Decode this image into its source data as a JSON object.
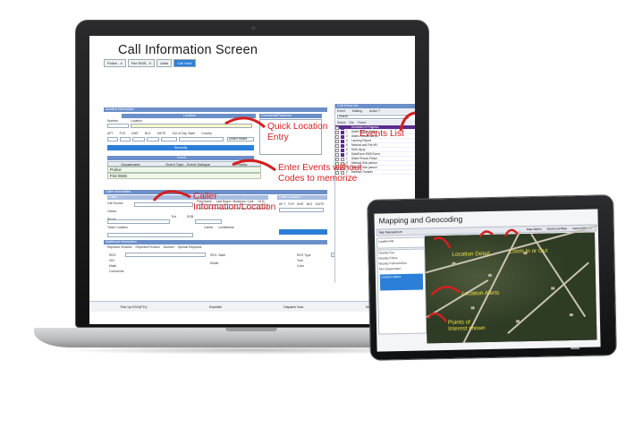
{
  "laptop": {
    "screen_title": "Call Information Screen",
    "tabs": [
      "Police - 4",
      "Fire EMS - 0",
      "Units",
      "Call Hold"
    ],
    "sections": {
      "incident": "Incident Information",
      "location_header": "Location",
      "comments": "Comments/Problems",
      "event": "Event",
      "caller": "Caller Information",
      "caller_left": "Caller",
      "caller_right": "Caller Location",
      "additional": "Additional Information"
    },
    "field_labels": {
      "number": "Number",
      "location": "Location",
      "apt": "APT",
      "flr": "FLR",
      "unit": "UNIT",
      "bld": "BLD",
      "suite": "SUITE",
      "out_of_city": "Out of City, State",
      "country": "Country",
      "country_value": "United States",
      "geoverify": "Geoverify"
    },
    "event_table": {
      "headers": [
        "Department",
        "Event Type - Event Subtype",
        "Priority"
      ],
      "rows": [
        "Police",
        "Fire EMS"
      ]
    },
    "caller_fields": [
      "Call Source",
      "Citizen",
      "Phone",
      "Tower Location"
    ],
    "caller_cols": [
      "First Name",
      "Last Name / Business / Unit",
      "OLN",
      "OLN State"
    ],
    "caller_extra": [
      "Ext",
      "DOB",
      "Carrier",
      "confidential"
    ],
    "caller_location_labels": [
      "AP T",
      "FLR",
      "UNIT",
      "BLD",
      "SUITE",
      "Out of City, State",
      "Co"
    ],
    "additional_tabs": [
      "Reported Vehicles",
      "Reported Persons",
      "Number",
      "Special Requests"
    ],
    "vehicle_fields": [
      "REG.",
      "VIN",
      "Make",
      "Comments",
      "REG. State",
      "Model",
      "REG Type",
      "Year",
      "Color",
      "Passenger (P)"
    ],
    "event_list_panel": {
      "header": "CAD Event List",
      "cols": [
        "Event",
        "Waiting",
        "Active T"
      ],
      "search": "Search",
      "sub_cols": [
        "Select",
        "Dis.",
        "Event"
      ],
      "items": [
        {
          "n": "",
          "label": "Domestic in Progress",
          "highlight": true
        },
        {
          "n": "1",
          "label": "Aided Person-Police"
        },
        {
          "n": "2",
          "label": "Alarm-Residential Bu"
        },
        {
          "n": "4",
          "label": "Larceny-Report"
        },
        {
          "n": "6",
          "label": "Medical and Fire MV"
        },
        {
          "n": "5",
          "label": "MVA-Injury"
        },
        {
          "n": "0",
          "label": "DataForce EMS Event"
        },
        {
          "n": "1",
          "label": "Aided Person-Police"
        },
        {
          "n": "0",
          "label": "Medical-Sick person"
        },
        {
          "n": "0",
          "label": "Medical-Sick person"
        },
        {
          "n": "0",
          "label": "Medical-Transfer"
        }
      ]
    },
    "bottom_buttons": [
      "Pick Up E911(F11)",
      "Expedite",
      "Dispatch Now",
      "Send to Disp"
    ],
    "callouts": {
      "quick_location": "Quick Location Entry",
      "events_list": "Events List",
      "enter_events": "Enter Events without Codes to memorize",
      "caller_info": "Caller Information/Location"
    }
  },
  "tablet": {
    "title": "Mapping and Geocoding",
    "toolbar_label": "Map Management",
    "toolbar_buttons": [
      "Map Option",
      "Save/Load Map",
      "Layers Help (F)"
    ],
    "side_labels": [
      "Location Info",
      "Nearby Fire",
      "Nearby Police",
      "Nearby Police/In/Out",
      "Fire Department",
      "Location Alerts"
    ],
    "callouts": {
      "location_detail": "Location Detail",
      "zoom": "Zoom In or Out",
      "location_alerts": "Location Alerts",
      "poi": "Points of Interest shown"
    }
  },
  "colors": {
    "callout_red": "#d41f1f",
    "tablet_callout_yellow": "#f2e042",
    "section_blue": "#6b8fc8",
    "button_blue": "#2b7fd8",
    "event_purple": "#5b2b8f"
  }
}
